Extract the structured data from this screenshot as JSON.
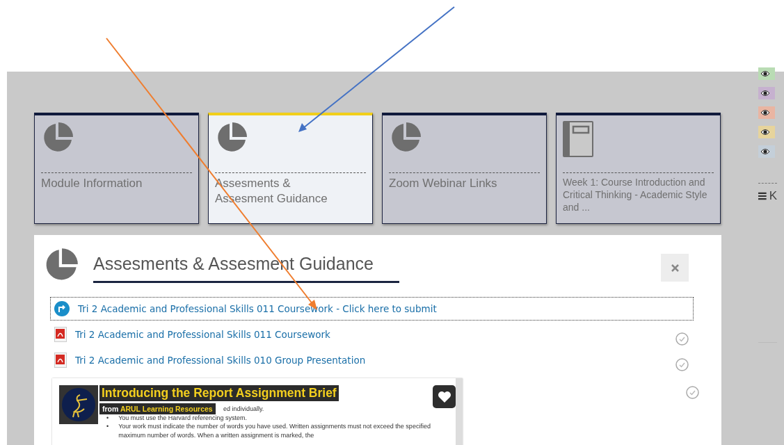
{
  "tiles": [
    {
      "title": "Module Information",
      "kind": "chart",
      "selected": false
    },
    {
      "title": "Assesments & Assesment Guidance",
      "kind": "chart",
      "selected": true
    },
    {
      "title": "Zoom Webinar Links",
      "kind": "chart",
      "selected": false
    },
    {
      "title": "Week 1: Course Introduction and Critical Thinking - Academic Style and ...",
      "kind": "book",
      "selected": false
    }
  ],
  "panel": {
    "title": "Assesments & Assesment Guidance",
    "activities": [
      {
        "kind": "assignment",
        "label": "Tri 2 Academic and Professional Skills 011 Coursework - Click here to submit",
        "focused": true,
        "tracked": false
      },
      {
        "kind": "pdf",
        "label": "Tri 2 Academic and Professional Skills 011 Coursework",
        "focused": false,
        "tracked": true
      },
      {
        "kind": "pdf",
        "label": "Tri 2 Academic and Professional Skills 010 Group Presentation",
        "focused": false,
        "tracked": true
      }
    ],
    "video": {
      "title": "Introducing the Report Assignment Brief",
      "source_prefix": "from",
      "source": "ARUL Learning Resources",
      "tracked": true,
      "lines": [
        {
          "text": "ed individually."
        },
        {
          "bullet": "•",
          "text": "You must use the Harvard referencing system."
        },
        {
          "bullet": "•",
          "text": "Your work must indicate the number of words you have used.  Written assignments must not exceed the specified maximum number of words.  When a written assignment is marked, the"
        }
      ]
    }
  },
  "side": {
    "swatches": [
      {
        "color": "#b9dcb4"
      },
      {
        "color": "#c6b1cf"
      },
      {
        "color": "#e9b5a2"
      },
      {
        "color": "#e7d49c"
      },
      {
        "color": "#c4cfd9"
      }
    ],
    "menu_label": "K"
  }
}
